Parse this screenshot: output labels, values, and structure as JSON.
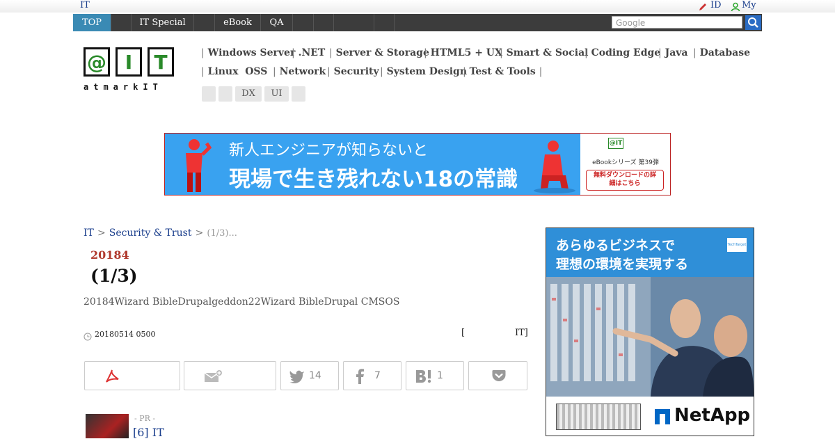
{
  "topbar": {
    "home_link": "IT",
    "id_link": "ID",
    "my_link": "My"
  },
  "nav": {
    "items": [
      {
        "label": "TOP"
      },
      {
        "label": ""
      },
      {
        "label": "IT Special"
      },
      {
        "label": ""
      },
      {
        "label": "eBook"
      },
      {
        "label": "QA"
      },
      {
        "label": ""
      },
      {
        "label": ""
      },
      {
        "label": ""
      },
      {
        "label": ""
      }
    ],
    "search_placeholder": "Google"
  },
  "logo": {
    "chars": [
      "@",
      "I",
      "T"
    ],
    "subtext": "atmarkIT"
  },
  "categories": {
    "row1": [
      "Windows Server",
      ".NET",
      "Server & Storage",
      "HTML5 + UX",
      "Smart & Social",
      "Coding Edge",
      "Java",
      "Database"
    ],
    "row2": [
      "Linux  OSS",
      "Network",
      "Security",
      "System Design",
      "Test & Tools"
    ],
    "tags": [
      "",
      "",
      "DX",
      "UI",
      ""
    ]
  },
  "banner": {
    "line1": "新人エンジニアが知らないと",
    "line2": "現場で生き残れない18の常識",
    "series": "eBookシリーズ 第39弾",
    "logo": "@IT",
    "cta": "無料ダウンロードの詳細はこちら"
  },
  "breadcrumb": {
    "home": "IT",
    "sep": ">",
    "section": "Security & Trust",
    "current": "(1/3)..."
  },
  "article": {
    "series_title": "20184",
    "title": "(1/3)",
    "summary": "20184Wizard BibleDrupalgeddon22Wizard BibleDrupal CMSOS",
    "date": "20180514 0500",
    "author_open": "[",
    "author_close": "IT]"
  },
  "share": {
    "twitter_count": "14",
    "facebook_count": "7",
    "hatena_count": "1"
  },
  "pr": {
    "label": "- PR -",
    "link": "[6] IT"
  },
  "side_ad": {
    "line1": "あらゆるビジネスで",
    "line2": "理想の環境を実現する",
    "brand": "NetApp",
    "badge": "TechTarget"
  }
}
